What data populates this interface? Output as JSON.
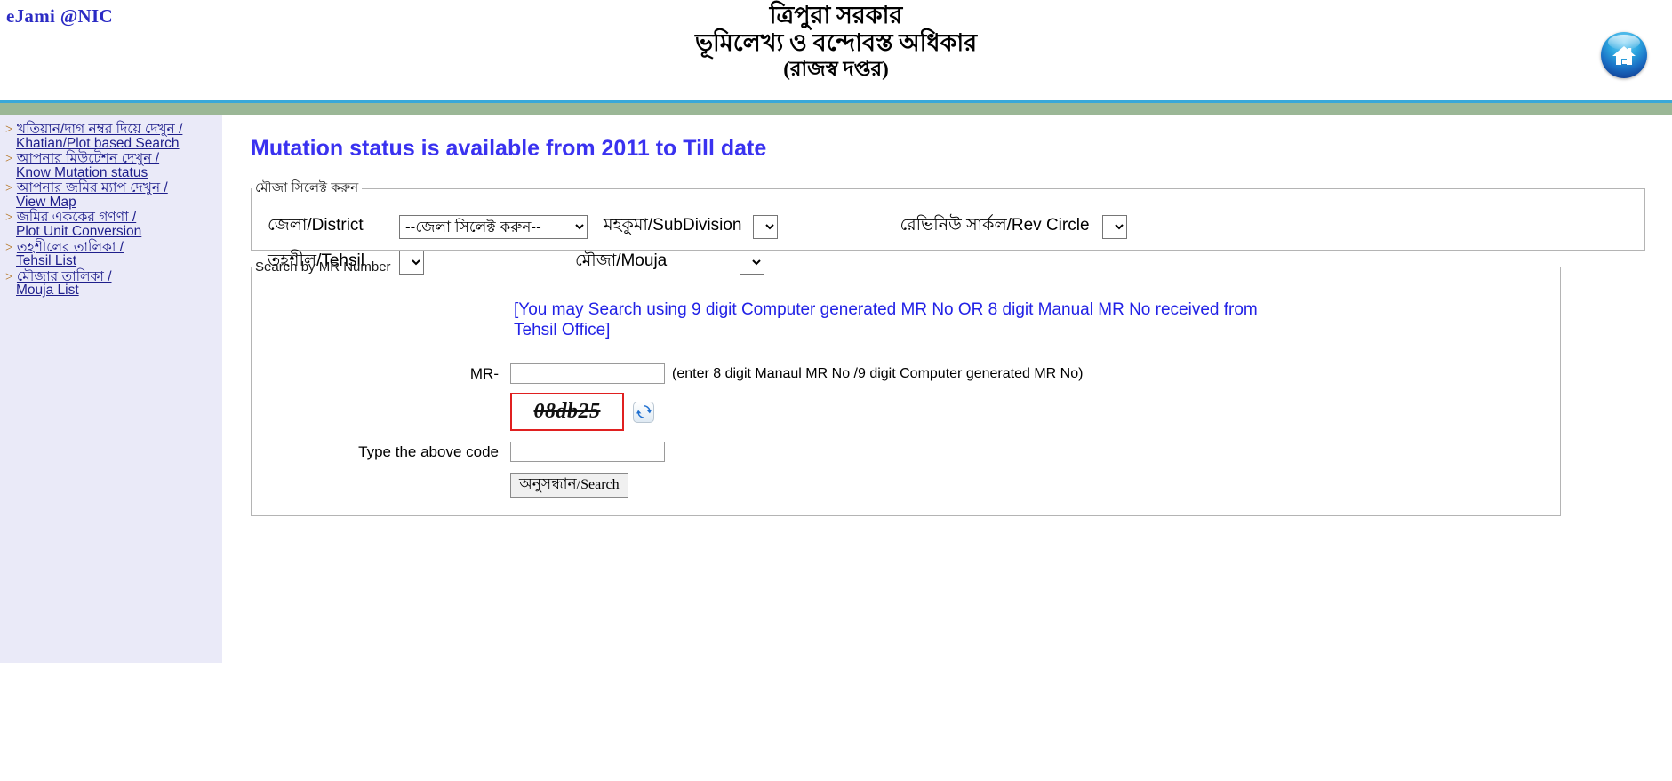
{
  "header": {
    "brand": "eJami @NIC",
    "title_line1": "ত্রিপুরা সরকার",
    "title_line2": "ভূমিলেখ্য ও বন্দোবস্ত অধিকার",
    "title_line3": "(রাজস্ব দপ্তর)",
    "home_icon": "home-icon",
    "rule_blue_color": "#3aa8d8",
    "rule_green_color": "#9bb796"
  },
  "sidebar": {
    "background_color": "#eaeaf8",
    "bullet": ">",
    "items": [
      {
        "line1": "খতিয়ান/দাগ নম্বর দিয়ে দেখুন /",
        "line2": "Khatian/Plot based Search",
        "name": "khatian-plot-search"
      },
      {
        "line1": "আপনার মিউটেশন দেখুন /",
        "line2": "Know Mutation status",
        "name": "know-mutation-status"
      },
      {
        "line1": "আপনার জমির ম্যাপ দেখুন /",
        "line2": "View Map",
        "name": "view-map"
      },
      {
        "line1": "জমির এককের গণণা /",
        "line2": "Plot Unit Conversion",
        "name": "plot-unit-conversion"
      },
      {
        "line1": "তহশীলের তালিকা /",
        "line2": "Tehsil List",
        "name": "tehsil-list"
      },
      {
        "line1": "মৌজার তালিকা /",
        "line2": "Mouja List",
        "name": "mouja-list"
      }
    ]
  },
  "main": {
    "heading": "Mutation status is available from  2011 to Till date",
    "heading_color": "#3a32f0",
    "mouja_fieldset": {
      "legend": "মৌজা সিলেক্ট করুন",
      "district_label": "জেলা/District",
      "district_value": "--জেলা সিলেক্ট করুন--",
      "subdivision_label": "মহকুমা/SubDivision",
      "subdivision_value": "",
      "revcircle_label": "রেভিনিউ সার্কল/Rev Circle",
      "revcircle_value": "",
      "tehsil_label": "তহশীল/Tehsil",
      "tehsil_value": "",
      "mouja_label": "মৌজা/Mouja",
      "mouja_value": ""
    },
    "search_fieldset": {
      "legend": "Search by MR Number",
      "instruction": "[You may Search using 9 digit Computer generated MR No OR 8 digit Manual MR No received from Tehsil Office]",
      "mr_label": "MR-",
      "mr_value": "",
      "mr_hint": "(enter 8 digit Manaul MR No /9 digit Computer generated MR No)",
      "captcha_text": "08db25",
      "captcha_border_color": "#e02020",
      "refresh_icon": "refresh-icon",
      "code_label": "Type the above code",
      "code_value": "",
      "search_button_bn": "অনুসন্ধান",
      "search_button_en": "/Search"
    }
  }
}
